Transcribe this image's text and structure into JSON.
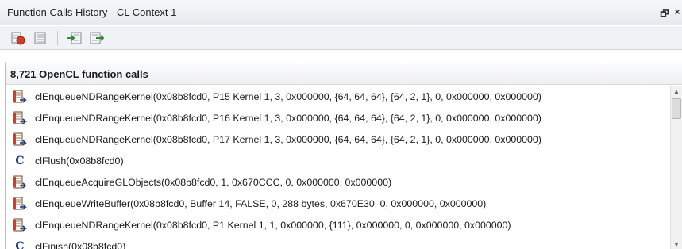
{
  "window": {
    "title": "Function Calls History - CL Context 1",
    "pin_glyph": "🗗",
    "close_glyph": "×"
  },
  "toolbar": {
    "buttons": [
      {
        "name": "record-calls-icon"
      },
      {
        "name": "show-calls-list-icon"
      },
      {
        "name": "step-in-icon"
      },
      {
        "name": "step-over-icon"
      }
    ]
  },
  "list": {
    "header": "8,721 OpenCL function calls",
    "rows": [
      {
        "icon": "kernel-command-icon",
        "text": "clEnqueueNDRangeKernel(0x08b8fcd0, P15 Kernel 1, 3, 0x000000, {64, 64, 64}, {64, 2, 1}, 0, 0x000000, 0x000000)"
      },
      {
        "icon": "kernel-command-icon",
        "text": "clEnqueueNDRangeKernel(0x08b8fcd0, P16 Kernel 1, 3, 0x000000, {64, 64, 64}, {64, 2, 1}, 0, 0x000000, 0x000000)"
      },
      {
        "icon": "kernel-command-icon",
        "text": "clEnqueueNDRangeKernel(0x08b8fcd0, P17 Kernel 1, 3, 0x000000, {64, 64, 64}, {64, 2, 1}, 0, 0x000000, 0x000000)"
      },
      {
        "icon": "context-c-icon",
        "text": "clFlush(0x08b8fcd0)"
      },
      {
        "icon": "kernel-command-icon",
        "text": "clEnqueueAcquireGLObjects(0x08b8fcd0, 1, 0x670CCC, 0, 0x000000, 0x000000)"
      },
      {
        "icon": "kernel-command-icon",
        "text": "clEnqueueWriteBuffer(0x08b8fcd0, Buffer 14, FALSE, 0, 288 bytes, 0x670E30, 0, 0x000000, 0x000000)"
      },
      {
        "icon": "kernel-command-icon",
        "text": "clEnqueueNDRangeKernel(0x08b8fcd0, P1 Kernel 1, 1, 0x000000, {111}, 0x000000, 0, 0x000000, 0x000000)"
      },
      {
        "icon": "context-c-icon",
        "text": "clFinish(0x08b8fcd0)"
      }
    ]
  },
  "colors": {
    "accent_red": "#d63a2a",
    "accent_blue": "#1d3b8a",
    "accent_green": "#2f8a3a"
  }
}
